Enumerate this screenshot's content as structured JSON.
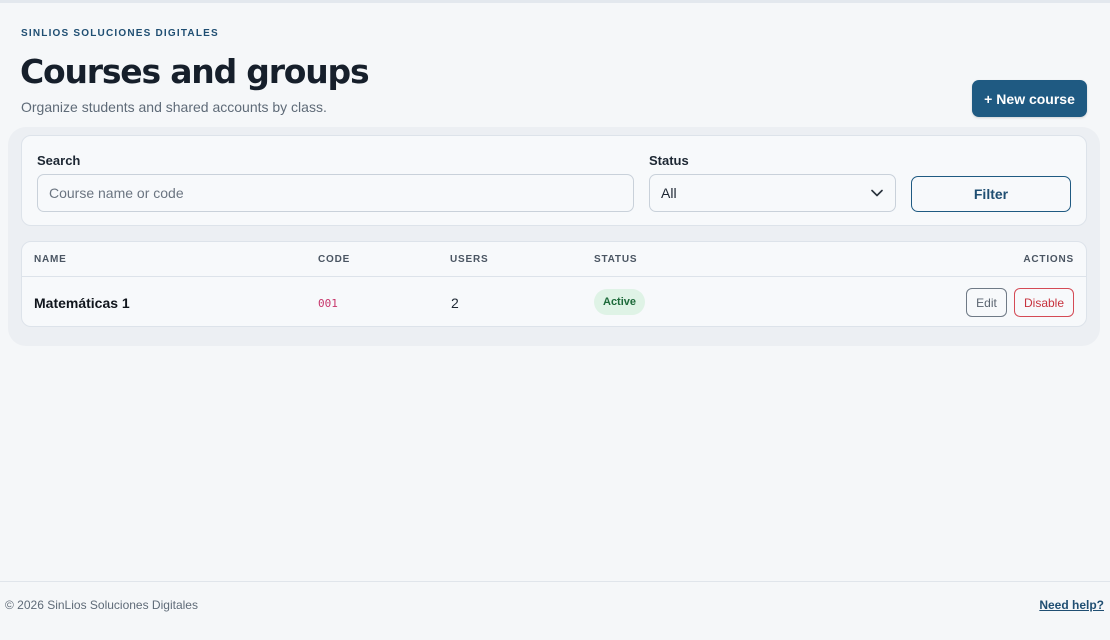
{
  "header": {
    "brand": "SINLIOS SOLUCIONES DIGITALES",
    "title": "Courses and groups",
    "subtitle": "Organize students and shared accounts by class.",
    "new_course_plus": "+",
    "new_course_label": "New course"
  },
  "filters": {
    "search_label": "Search",
    "search_placeholder": "Course name or code",
    "search_value": "",
    "status_label": "Status",
    "status_value": "All",
    "filter_button": "Filter"
  },
  "table": {
    "columns": {
      "name": "NAME",
      "code": "CODE",
      "users": "USERS",
      "status": "STATUS",
      "actions": "ACTIONS"
    },
    "rows": [
      {
        "name": "Matemáticas 1",
        "code": "001",
        "users": "2",
        "status": "Active",
        "edit_label": "Edit",
        "disable_label": "Disable"
      }
    ]
  },
  "footer": {
    "copyright": "© 2026 SinLios Soluciones Digitales",
    "help_link": "Need help?"
  },
  "colors": {
    "primary": "#1f5a82",
    "active_badge_bg": "#dff3e6",
    "active_badge_text": "#1d6a3a",
    "danger": "#c7323e",
    "code_text": "#c7366b"
  },
  "icons": {
    "status_select": "chevron-down-icon"
  }
}
